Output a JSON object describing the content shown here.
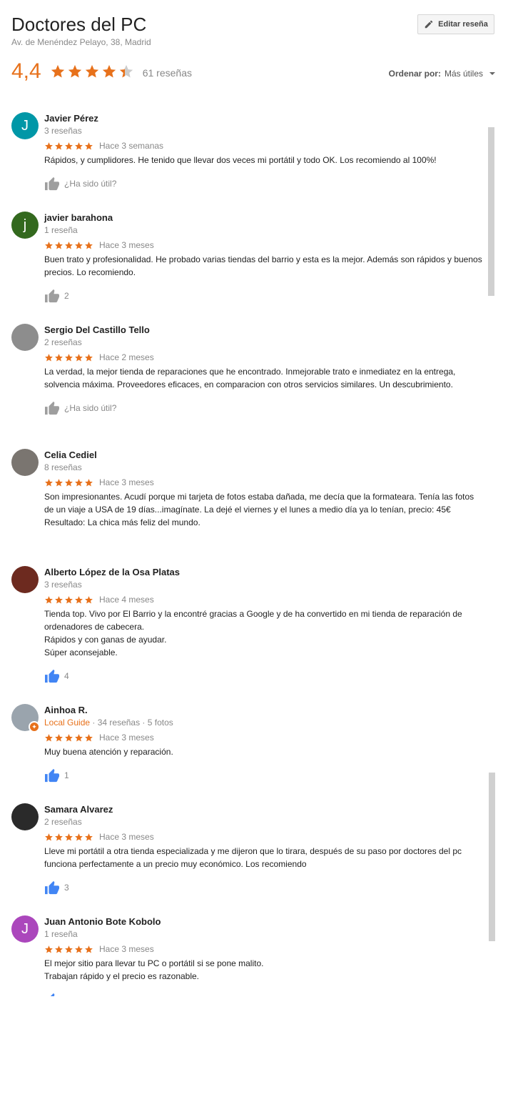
{
  "place": {
    "name": "Doctores del PC",
    "address": "Av. de Menéndez Pelayo, 38, Madrid",
    "edit_label": "Editar reseña"
  },
  "summary": {
    "score": "4,4",
    "stars": 4.4,
    "count": "61 reseñas",
    "sort_label": "Ordenar por:",
    "sort_value": "Más útiles"
  },
  "colors": {
    "star": "#e7711b",
    "thumb_grey": "#9e9e9e",
    "thumb_blue": "#4285f4"
  },
  "reviews": [
    {
      "initial": "J",
      "avatar_color": "#0097a7",
      "name": "Javier Pérez",
      "meta": "3 reseñas",
      "local_guide": "",
      "time": "Hace 3 semanas",
      "text": "Rápidos, y cumplidores. He tenido que llevar dos veces mi portátil y todo OK. Los recomiendo al 100%!",
      "helpful": "¿Ha sido útil?",
      "liked": false
    },
    {
      "initial": "j",
      "avatar_color": "#33691e",
      "name": "javier barahona",
      "meta": "1 reseña",
      "local_guide": "",
      "time": "Hace 3 meses",
      "text": "Buen trato y profesionalidad. He probado varias tiendas del barrio y esta es la mejor. Además son rápidos y buenos precios. Lo recomiendo.",
      "helpful": "2",
      "liked": false
    },
    {
      "initial": "",
      "avatar_color": "#8d8d8d",
      "name": "Sergio Del Castillo Tello",
      "meta": "2 reseñas",
      "local_guide": "",
      "time": "Hace 2 meses",
      "text": "La verdad, la mejor tienda de reparaciones que he encontrado. Inmejorable trato e inmediatez en la entrega, solvencia máxima. Proveedores eficaces, en comparacion con otros servicios similares. Un descubrimiento.",
      "helpful": "¿Ha sido útil?",
      "liked": false
    },
    {
      "initial": "",
      "avatar_color": "#7a7570",
      "name": "Celia Cediel",
      "meta": "8 reseñas",
      "local_guide": "",
      "time": "Hace 3 meses",
      "text": "Son impresionantes. Acudí porque mi tarjeta de fotos estaba dañada, me decía que la formateara. Tenía las fotos de un viaje a USA de 19 días...imagínate. La dejé el viernes y el lunes a medio día ya lo tenían, precio: 45€ Resultado: La chica más feliz del mundo.",
      "helpful": "",
      "liked": false
    },
    {
      "initial": "",
      "avatar_color": "#6d2a1f",
      "name": "Alberto López de la Osa Platas",
      "meta": "3 reseñas",
      "local_guide": "",
      "time": "Hace 4 meses",
      "text": "Tienda top. Vivo por El Barrio y  la encontré gracias a Google y de ha convertido en mi tienda de reparación de ordenadores  de cabecera.\nRápidos y con ganas de ayudar.\nSúper aconsejable.",
      "helpful": "4",
      "liked": true
    },
    {
      "initial": "",
      "avatar_color": "#9aa4ad",
      "name": "Ainhoa R.",
      "meta": " · 34 reseñas · 5 fotos",
      "local_guide": "Local Guide",
      "time": "Hace 3 meses",
      "text": "Muy buena atención y reparación.",
      "helpful": "1",
      "liked": true
    },
    {
      "initial": "",
      "avatar_color": "#2a2a2a",
      "name": "Samara Alvarez",
      "meta": "2 reseñas",
      "local_guide": "",
      "time": "Hace 3 meses",
      "text": "Lleve mi portátil a otra tienda especializada y me dijeron que lo tirara, después de su paso por doctores del pc funciona perfectamente a un precio muy económico. Los recomiendo",
      "helpful": "3",
      "liked": true
    },
    {
      "initial": "J",
      "avatar_color": "#ab47bc",
      "name": "Juan Antonio Bote Kobolo",
      "meta": "1 reseña",
      "local_guide": "",
      "time": "Hace 3 meses",
      "text": "El mejor sitio para llevar tu PC o portátil si se pone malito.\nTrabajan rápido y el precio es razonable.",
      "helpful": "",
      "liked": true
    }
  ]
}
